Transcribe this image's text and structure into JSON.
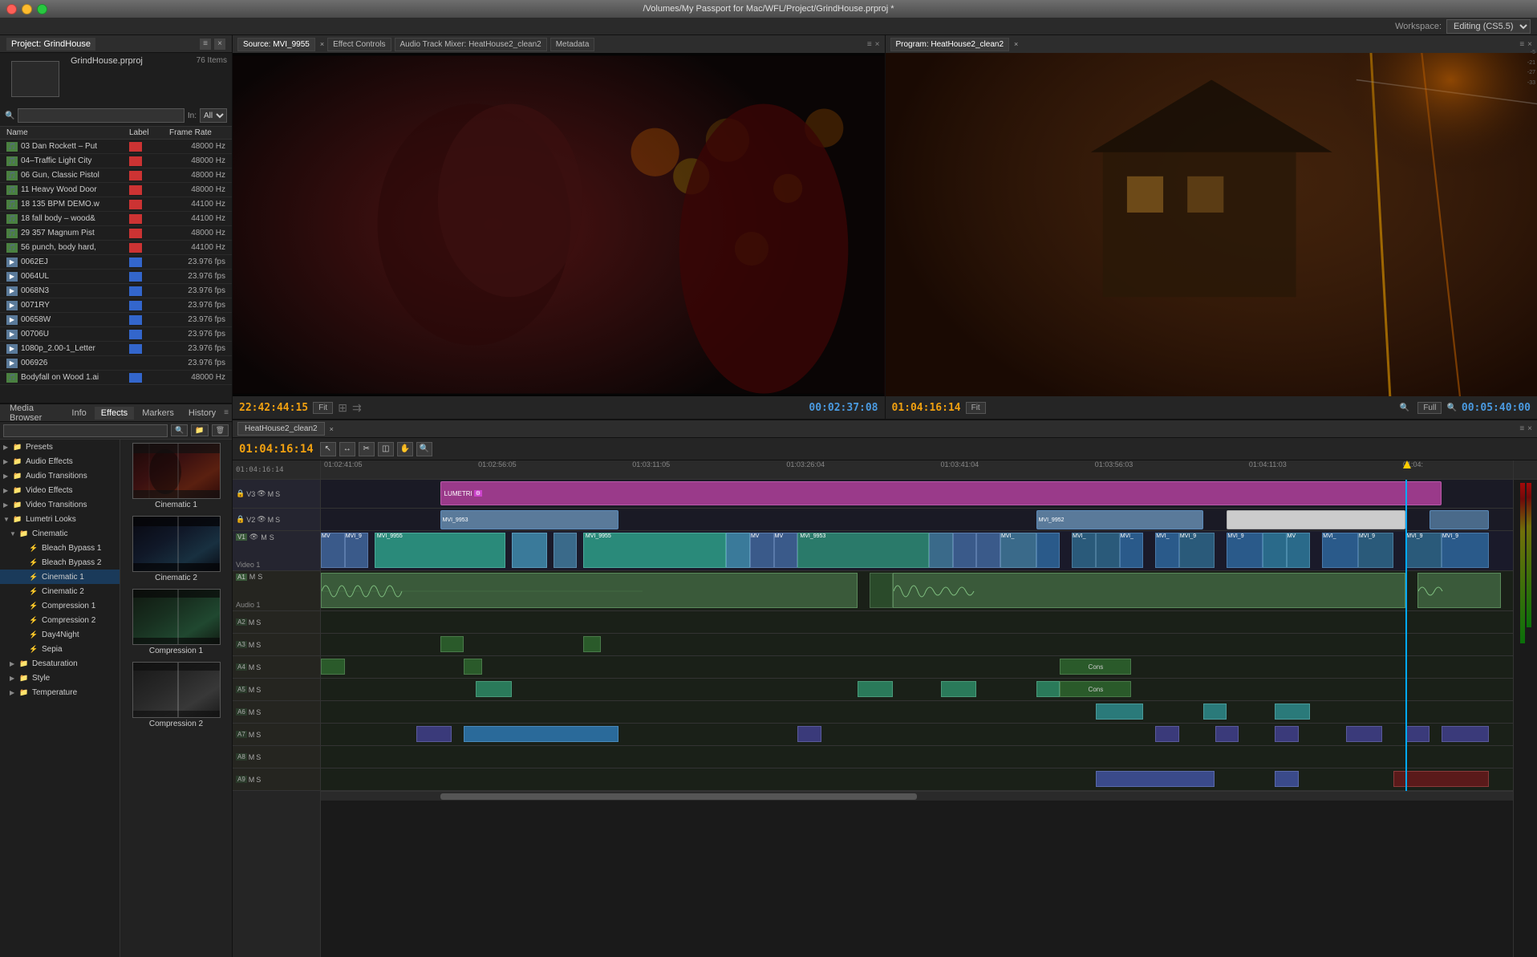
{
  "titlebar": {
    "title": "/Volumes/My Passport for Mac/WFL/Project/GrindHouse.prproj *"
  },
  "workspace": {
    "label": "Workspace:",
    "value": "Editing (CS5.5)"
  },
  "project": {
    "name": "GrindHouse.prproj",
    "count": "76 Items",
    "tab": "Project: GrindHouse",
    "search_placeholder": "",
    "in_label": "In:",
    "in_value": "All",
    "col_name": "Name",
    "col_label": "Label",
    "col_rate": "Frame Rate",
    "files": [
      {
        "name": "03 Dan Rockett – Put",
        "label": "red",
        "rate": "48000 Hz",
        "type": "audio"
      },
      {
        "name": "04–Traffic Light City",
        "label": "red",
        "rate": "48000 Hz",
        "type": "audio"
      },
      {
        "name": "06 Gun, Classic Pistol",
        "label": "red",
        "rate": "48000 Hz",
        "type": "audio"
      },
      {
        "name": "11 Heavy Wood Door",
        "label": "red",
        "rate": "48000 Hz",
        "type": "audio"
      },
      {
        "name": "18 135 BPM DEMO.w",
        "label": "red",
        "rate": "44100 Hz",
        "type": "audio"
      },
      {
        "name": "18 fall body – wood&",
        "label": "red",
        "rate": "44100 Hz",
        "type": "audio"
      },
      {
        "name": "29 357 Magnum Pist",
        "label": "red",
        "rate": "48000 Hz",
        "type": "audio"
      },
      {
        "name": "56 punch, body hard,",
        "label": "red",
        "rate": "44100 Hz",
        "type": "audio"
      },
      {
        "name": "0062EJ",
        "label": "blue",
        "rate": "23.976 fps",
        "type": "video"
      },
      {
        "name": "0064UL",
        "label": "blue",
        "rate": "23.976 fps",
        "type": "video"
      },
      {
        "name": "0068N3",
        "label": "blue",
        "rate": "23.976 fps",
        "type": "video"
      },
      {
        "name": "0071RY",
        "label": "blue",
        "rate": "23.976 fps",
        "type": "video"
      },
      {
        "name": "00658W",
        "label": "blue",
        "rate": "23.976 fps",
        "type": "video"
      },
      {
        "name": "00706U",
        "label": "blue",
        "rate": "23.976 fps",
        "type": "video"
      },
      {
        "name": "1080p_2.00-1_Letter",
        "label": "blue",
        "rate": "23.976 fps",
        "type": "video"
      },
      {
        "name": "006926",
        "label": "",
        "rate": "23.976 fps",
        "type": "video"
      },
      {
        "name": "Bodyfall on Wood 1.ai",
        "label": "blue",
        "rate": "48000 Hz",
        "type": "audio"
      }
    ]
  },
  "effects_panel": {
    "tabs": [
      "Media Browser",
      "Info",
      "Effects",
      "Markers",
      "History"
    ],
    "active_tab": "Effects",
    "tree": [
      {
        "label": "Presets",
        "level": 0,
        "hasArrow": true,
        "expanded": false
      },
      {
        "label": "Audio Effects",
        "level": 0,
        "hasArrow": true,
        "expanded": false
      },
      {
        "label": "Audio Transitions",
        "level": 0,
        "hasArrow": true,
        "expanded": false
      },
      {
        "label": "Video Effects",
        "level": 0,
        "hasArrow": true,
        "expanded": false
      },
      {
        "label": "Video Transitions",
        "level": 0,
        "hasArrow": true,
        "expanded": false
      },
      {
        "label": "Lumetri Looks",
        "level": 0,
        "hasArrow": true,
        "expanded": true
      },
      {
        "label": "Cinematic",
        "level": 1,
        "hasArrow": true,
        "expanded": true
      },
      {
        "label": "Bleach Bypass 1",
        "level": 2,
        "hasArrow": false,
        "expanded": false
      },
      {
        "label": "Bleach Bypass 2",
        "level": 2,
        "hasArrow": false,
        "expanded": false
      },
      {
        "label": "Cinematic 1",
        "level": 2,
        "hasArrow": false,
        "expanded": false,
        "selected": true
      },
      {
        "label": "Cinematic 2",
        "level": 2,
        "hasArrow": false,
        "expanded": false
      },
      {
        "label": "Compression 1",
        "level": 2,
        "hasArrow": false,
        "expanded": false
      },
      {
        "label": "Compression 2",
        "level": 2,
        "hasArrow": false,
        "expanded": false
      },
      {
        "label": "Day4Night",
        "level": 2,
        "hasArrow": false,
        "expanded": false
      },
      {
        "label": "Sepia",
        "level": 2,
        "hasArrow": false,
        "expanded": false
      },
      {
        "label": "Desaturation",
        "level": 1,
        "hasArrow": true,
        "expanded": false
      },
      {
        "label": "Style",
        "level": 1,
        "hasArrow": true,
        "expanded": false
      },
      {
        "label": "Temperature",
        "level": 1,
        "hasArrow": true,
        "expanded": false
      }
    ],
    "thumbnails": [
      {
        "label": "Cinematic 1",
        "style": "cinematic1"
      },
      {
        "label": "Cinematic 2",
        "style": "cinematic2"
      },
      {
        "label": "Compression 1",
        "style": "compression1"
      },
      {
        "label": "Compression 2",
        "style": "compression2"
      }
    ]
  },
  "source_monitor": {
    "title": "Source: MVI_9955",
    "tabs": [
      "Effect Controls",
      "Audio Track Mixer: HeatHouse2_clean2",
      "Metadata"
    ],
    "timecode": "22:42:44:15",
    "fit_label": "Fit",
    "timecode2": "00:02:37:08"
  },
  "program_monitor": {
    "title": "Program: HeatHouse2_clean2",
    "timecode": "01:04:16:14",
    "fit_label": "Fit",
    "timecode2": "00:05:40:00"
  },
  "timeline": {
    "title": "HeatHouse2_clean2",
    "timecode": "01:04:16:14",
    "rulers": [
      "01:02:41:05",
      "01:02:56:05",
      "01:03:11:05",
      "01:03:26:04",
      "01:03:41:04",
      "01:03:56:03",
      "01:04:11:03",
      "01:04:"
    ],
    "tracks": [
      {
        "id": "V3",
        "type": "video"
      },
      {
        "id": "V2",
        "type": "video"
      },
      {
        "id": "V1",
        "type": "video",
        "sublabel": "Video 1"
      },
      {
        "id": "A1",
        "type": "audio",
        "sublabel": "Audio 1"
      },
      {
        "id": "A2",
        "type": "audio"
      },
      {
        "id": "A3",
        "type": "audio"
      },
      {
        "id": "A4",
        "type": "audio"
      },
      {
        "id": "A5",
        "type": "audio"
      },
      {
        "id": "A6",
        "type": "audio"
      },
      {
        "id": "A7",
        "type": "audio"
      },
      {
        "id": "A8",
        "type": "audio"
      },
      {
        "id": "A9",
        "type": "audio"
      }
    ],
    "cons_labels": [
      "Cons",
      "Cons"
    ]
  },
  "bleach_bypass_text": "Bleach Bypass"
}
